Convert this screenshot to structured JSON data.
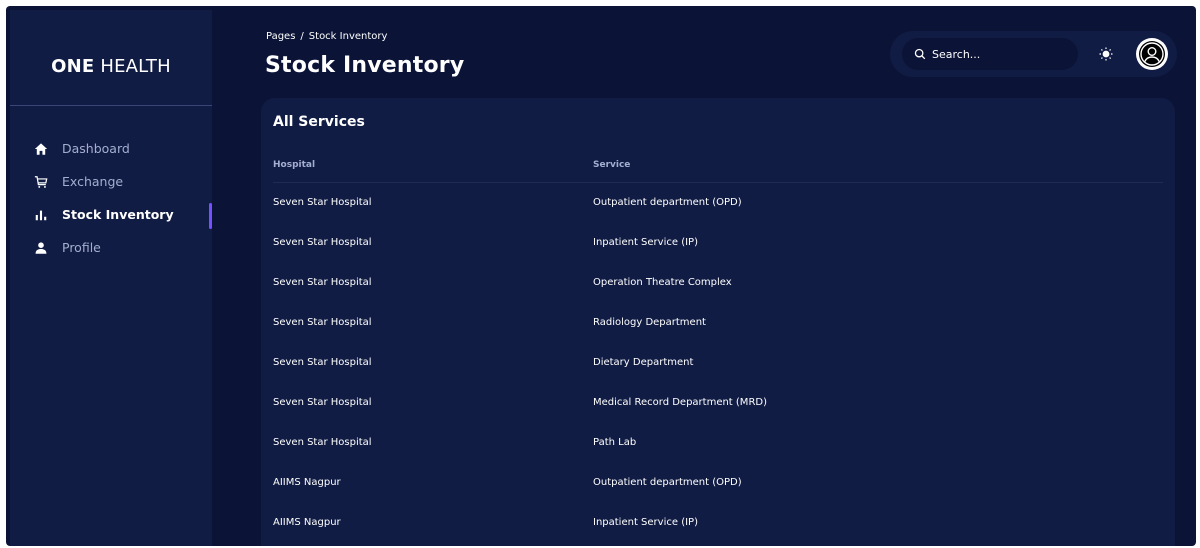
{
  "brand": {
    "bold": "ONE",
    "light": "HEALTH"
  },
  "sidebar": {
    "items": [
      {
        "label": "Dashboard",
        "icon": "home-icon",
        "active": false
      },
      {
        "label": "Exchange",
        "icon": "cart-icon",
        "active": false
      },
      {
        "label": "Stock Inventory",
        "icon": "bar-chart-icon",
        "active": true
      },
      {
        "label": "Profile",
        "icon": "user-icon",
        "active": false
      }
    ]
  },
  "header": {
    "breadcrumb_root": "Pages",
    "breadcrumb_sep": "/",
    "breadcrumb_current": "Stock Inventory",
    "title": "Stock Inventory"
  },
  "topbar": {
    "search_placeholder": "Search...",
    "theme_icon": "sun-icon",
    "avatar_icon": "user-circle-icon"
  },
  "card": {
    "title": "All Services",
    "columns": [
      "Hospital",
      "Service"
    ],
    "rows": [
      {
        "hospital": "Seven Star Hospital",
        "service": "Outpatient department (OPD)"
      },
      {
        "hospital": "Seven Star Hospital",
        "service": "Inpatient Service (IP)"
      },
      {
        "hospital": "Seven Star Hospital",
        "service": "Operation Theatre Complex"
      },
      {
        "hospital": "Seven Star Hospital",
        "service": "Radiology Department"
      },
      {
        "hospital": "Seven Star Hospital",
        "service": "Dietary Department"
      },
      {
        "hospital": "Seven Star Hospital",
        "service": "Medical Record Department (MRD)"
      },
      {
        "hospital": "Seven Star Hospital",
        "service": "Path Lab"
      },
      {
        "hospital": "AIIMS Nagpur",
        "service": "Outpatient department (OPD)"
      },
      {
        "hospital": "AIIMS Nagpur",
        "service": "Inpatient Service (IP)"
      }
    ]
  },
  "colors": {
    "background": "#0b1437",
    "panel": "#111c44",
    "accent": "#7551ff",
    "muted_text": "#a3aed0"
  }
}
